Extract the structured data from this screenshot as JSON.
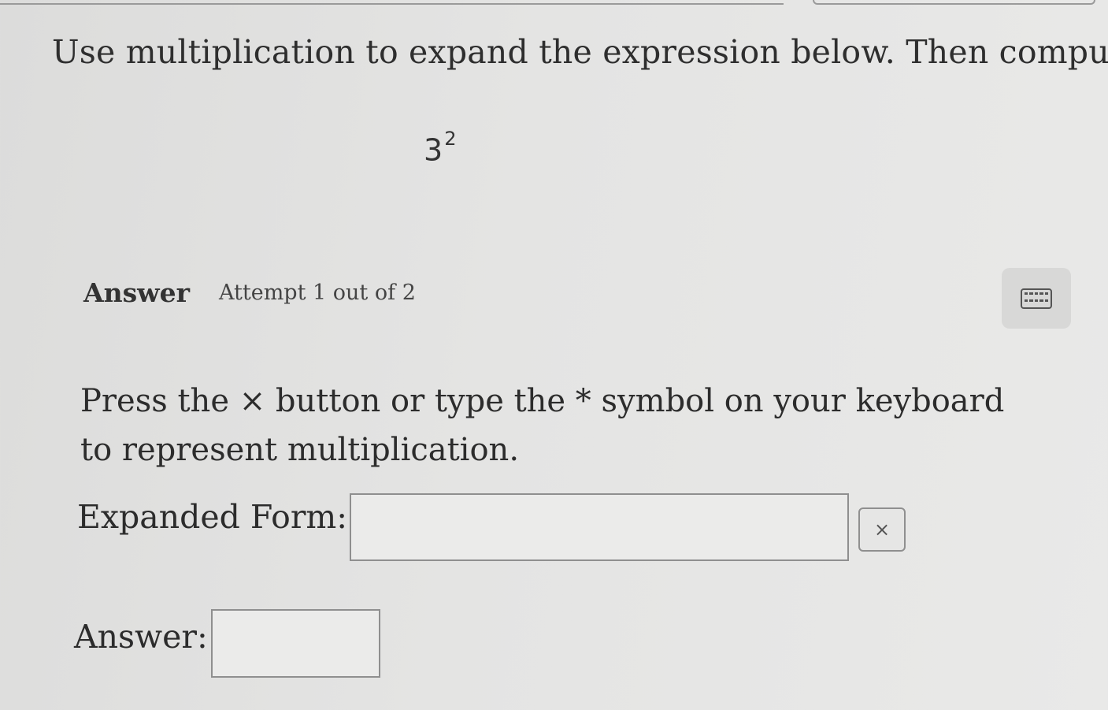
{
  "question": {
    "prompt": "Use multiplication to expand the expression below. Then compute.",
    "expression_base": "3",
    "expression_exponent": "2"
  },
  "answer_section": {
    "heading": "Answer",
    "attempt": "Attempt 1 out of 2",
    "keyboard_icon": "keyboard-icon"
  },
  "instruction": {
    "text": "Press the × button or type the * symbol on your keyboard to represent multiplication."
  },
  "expanded_form": {
    "label": "Expanded Form:",
    "value": "",
    "times_button_label": "×"
  },
  "answer": {
    "label": "Answer:",
    "value": ""
  }
}
